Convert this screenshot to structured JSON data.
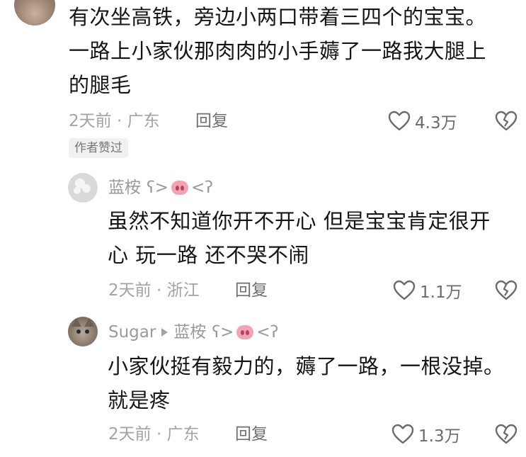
{
  "top_comment": {
    "text_lines": [
      "有次坐高铁，旁边小两口带着三四个的宝宝。",
      "一路上小家伙那肉肉的小手薅了一路我大腿上",
      "的腿毛"
    ],
    "time_location": "2天前 · 广东",
    "reply_label": "回复",
    "like_count": "4.3万",
    "badge": "作者赞过"
  },
  "reply1": {
    "username": "蓝桉",
    "suffix_before": "ʕ>",
    "suffix_after": "<ʔ",
    "text_lines": [
      "虽然不知道你开不开心 但是宝宝肯定很开",
      "心 玩一路 还不哭不闹"
    ],
    "time_location": "2天前 · 浙江",
    "reply_label": "回复",
    "like_count": "1.1万"
  },
  "reply2": {
    "username": "Sugar",
    "reply_to": "蓝桉",
    "suffix_before": "ʕ>",
    "suffix_after": "<ʔ",
    "text_lines": [
      "小家伙挺有毅力的，薅了一路，一根没掉。",
      "就是疼"
    ],
    "time_location": "2天前 · 广东",
    "reply_label": "回复",
    "like_count": "1.3万"
  },
  "icons": {
    "like": "heart-outline-icon",
    "dislike": "broken-heart-icon",
    "pig": "pig-nose-emoji-icon",
    "reply_arrow": "play-triangle-icon"
  },
  "colors": {
    "text": "#161616",
    "meta": "#a3a3a3",
    "icon": "#6b6b6b",
    "pig": "#f4a3b4"
  }
}
